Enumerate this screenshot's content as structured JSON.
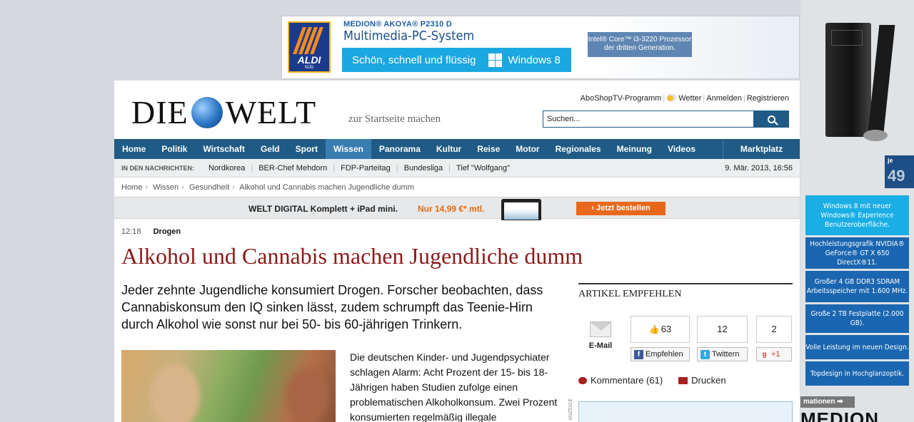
{
  "top_ad": {
    "brand": "ALDI",
    "brand_sub": "SÜD",
    "model": "MEDION® AKOYA® P2310 D",
    "title": "Multimedia-PC-System",
    "tagline": "Schön, schnell und flüssig",
    "windows": "Windows 8",
    "intel": "Intel® Core™ i3-3220 Prozessor der dritten Generation."
  },
  "side_ad": {
    "price_pre": "je",
    "price": "49",
    "features": [
      "Windows 8 mit neuer Windows® Experience Benutzeroberfläche.",
      "Hochleistungsgrafik NVIDIA® GeForce® GT X 650 DirectX®11.",
      "Großer 4 GB DDR3 SDRAM Arbeitsspeicher mit 1.600 MHz.",
      "Große 2 TB Festplatte (2.000 GB).",
      "Volle Leistung im neuen Design.",
      "Topdesign in Hochglanzoptik."
    ],
    "info_link": "mationen",
    "logo": "MEDION"
  },
  "header": {
    "logo_left": "DIE",
    "logo_right": "WELT",
    "startseite": "zur Startseite machen",
    "links": [
      "Abo",
      "Shop",
      "TV-Programm"
    ],
    "weather": "Wetter",
    "login": "Anmelden",
    "register": "Registrieren",
    "search_placeholder": "Suchen..."
  },
  "nav": {
    "items": [
      "Home",
      "Politik",
      "Wirtschaft",
      "Geld",
      "Sport",
      "Wissen",
      "Panorama",
      "Kultur",
      "Reise",
      "Motor",
      "Regionales",
      "Meinung",
      "Videos"
    ],
    "market": "Marktplatz"
  },
  "news": {
    "label": "IN DEN NACHRICHTEN:",
    "items": [
      "Nordkorea",
      "BER-Chef Mehdorn",
      "FDP-Parteitag",
      "Bundesliga",
      "Tief \"Wolfgang\""
    ],
    "date": "9. Mär. 2013, 16:56"
  },
  "breadcrumb": [
    "Home",
    "Wissen",
    "Gesundheit",
    "Alkohol und Cannabis machen Jugendliche dumm"
  ],
  "digital": {
    "text": "WELT DIGITAL Komplett + iPad mini.",
    "price": "Nur 14,99 €* mtl.",
    "cta": "› Jetzt bestellen"
  },
  "article": {
    "time": "12:18",
    "category": "Drogen",
    "headline": "Alkohol und Cannabis machen Jugendliche dumm",
    "intro": "Jeder zehnte Jugendliche konsumiert Drogen. Forscher beobachten, dass Cannabiskonsum den IQ sinken lässt, zudem schrumpft das Teenie-Hirn durch Alkohol wie sonst nur bei 50- bis 60-jährigen Trinkern.",
    "body": "Die deutschen Kinder- und Jugendpsychiater schlagen Alarm: Acht Prozent der 15- bis 18-Jährigen haben Studien zufolge einen problematischen Alkoholkonsum. Zwei Prozent konsumierten regelmäßig illegale"
  },
  "share": {
    "heading": "ARTIKEL EMPFEHLEN",
    "email": "E-Mail",
    "fb_count": "63",
    "fb_label": "Empfehlen",
    "tw_count": "12",
    "tw_label": "Twittern",
    "gp_count": "2",
    "gp_label": "+1",
    "comments": "Kommentare (61)",
    "print": "Drucken",
    "anzeige": "ANZEIGE"
  }
}
